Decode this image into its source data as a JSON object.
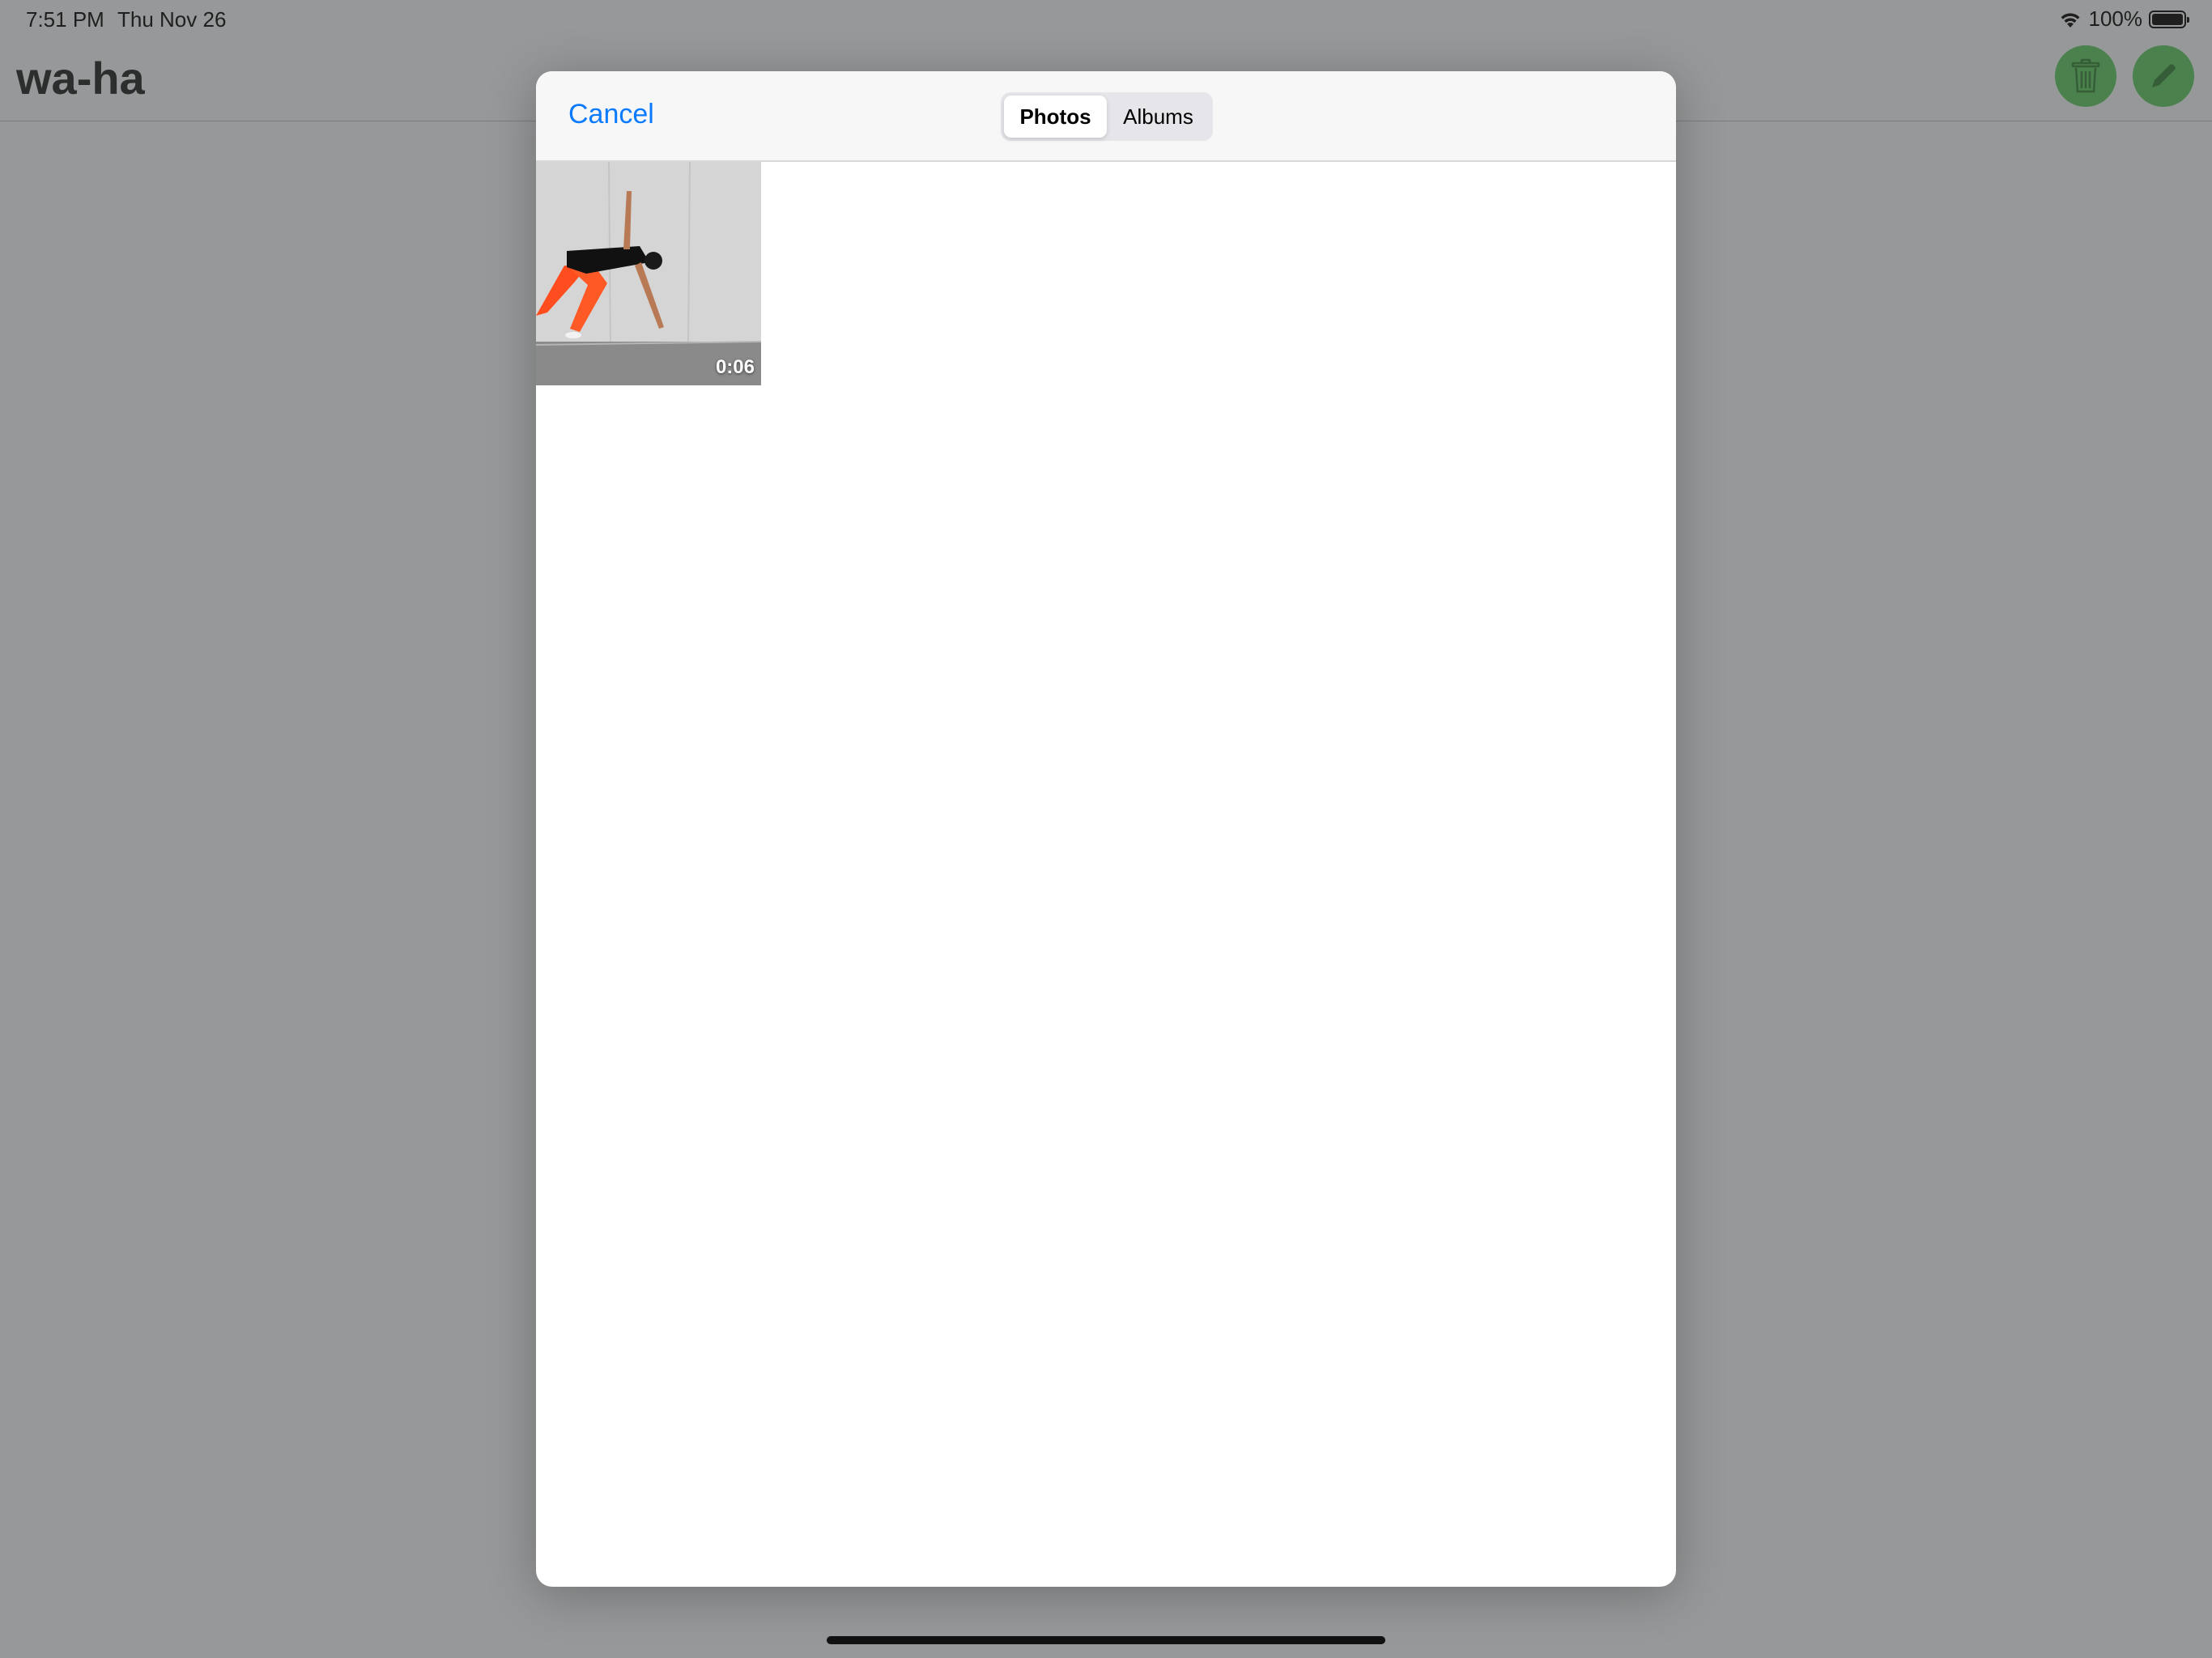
{
  "status_bar": {
    "time": "7:51 PM",
    "date": "Thu Nov 26",
    "battery": "100%"
  },
  "app": {
    "title": "wa-ha",
    "accent_color": "#5ac45c"
  },
  "picker": {
    "cancel_label": "Cancel",
    "tabs": [
      {
        "label": "Photos",
        "selected": true
      },
      {
        "label": "Albums",
        "selected": false
      }
    ],
    "items": [
      {
        "type": "video",
        "duration": "0:06"
      }
    ],
    "accent_color": "#0a7aff"
  }
}
